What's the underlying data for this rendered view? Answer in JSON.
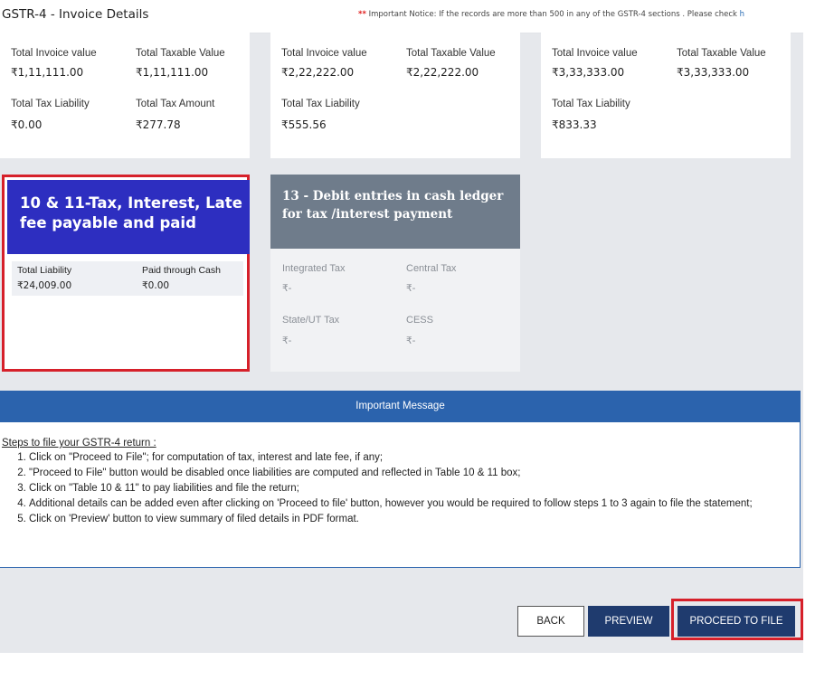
{
  "header": {
    "title": "GSTR-4 - Invoice Details",
    "notice_stars": "**",
    "notice_text": "Important Notice: If the records are more than 500 in any of the GSTR-4 sections . Please check",
    "notice_link": "h"
  },
  "summary_cards": [
    {
      "label_1": "Total Invoice value",
      "value_1": "₹1,11,111.00",
      "label_2": "Total Taxable Value",
      "value_2": "₹1,11,111.00",
      "label_3": "Total Tax Liability",
      "value_3": "₹0.00",
      "label_4": "Total Tax Amount",
      "value_4": "₹277.78"
    },
    {
      "label_1": "Total Invoice value",
      "value_1": "₹2,22,222.00",
      "label_2": "Total Taxable Value",
      "value_2": "₹2,22,222.00",
      "label_3": "Total Tax Liability",
      "value_3": "₹555.56"
    },
    {
      "label_1": "Total Invoice value",
      "value_1": "₹3,33,333.00",
      "label_2": "Total Taxable Value",
      "value_2": "₹3,33,333.00",
      "label_3": "Total Tax Liability",
      "value_3": "₹833.33"
    }
  ],
  "tile_10_11": {
    "title": "10 & 11-Tax, Interest, Late fee payable and paid",
    "total_liability_label": "Total Liability",
    "total_liability_value": "₹24,009.00",
    "paid_cash_label": "Paid through Cash",
    "paid_cash_value": "₹0.00"
  },
  "tile_13": {
    "title": "13 - Debit entries in cash ledger for tax /interest payment",
    "integrated_label": "Integrated Tax",
    "integrated_value": "₹-",
    "central_label": "Central Tax",
    "central_value": "₹-",
    "state_label": "State/UT Tax",
    "state_value": "₹-",
    "cess_label": "CESS",
    "cess_value": "₹-"
  },
  "message": {
    "heading": "Important Message",
    "steps_title": "Steps to file your GSTR-4 return :",
    "steps": [
      "Click on \"Proceed to File\"; for computation of tax, interest and late fee, if any;",
      "\"Proceed to File\" button would be disabled once liabilities are computed and reflected in Table 10 & 11 box;",
      "Click on \"Table 10 & 11\" to pay liabilities and file the return;",
      "Additional details can be added even after clicking on 'Proceed to file' button, however you would be required to follow steps 1 to 3 again to file the statement;",
      "Click on 'Preview' button to view summary of filed details in PDF format."
    ]
  },
  "buttons": {
    "back": "BACK",
    "preview": "PREVIEW",
    "proceed": "PROCEED TO FILE"
  },
  "colors": {
    "tile_blue": "#2d2ec0",
    "tile_gray": "#6f7c8b",
    "message_bar": "#2b63ad",
    "button_dark": "#1f3b6e",
    "highlight_red": "#d6202a"
  }
}
